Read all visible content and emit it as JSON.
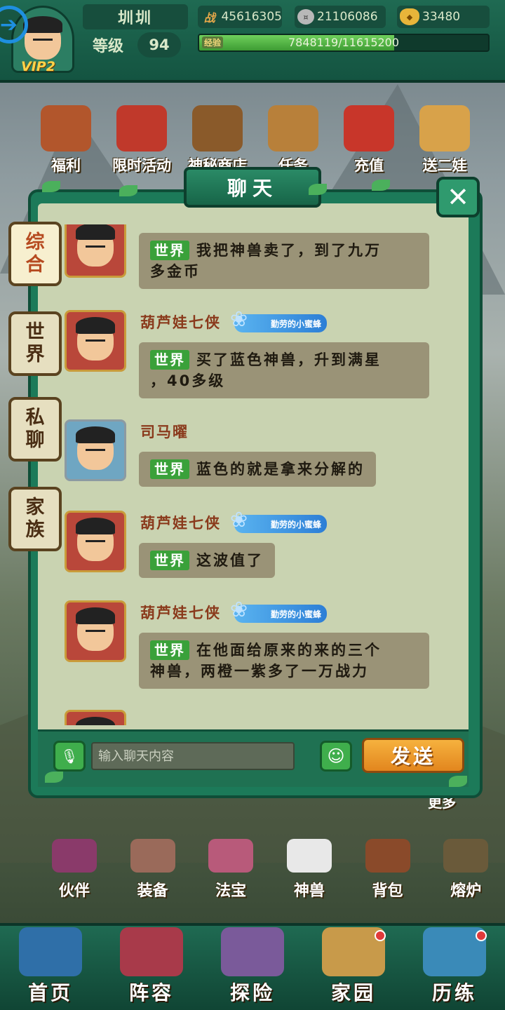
{
  "top_bar": {
    "player_name": "圳圳",
    "vip_label": "VIP2",
    "level_label": "等级",
    "level_value": "94",
    "power_icon_char": "战",
    "power_value": "45616305",
    "silver_value": "21106086",
    "gold_value": "33480",
    "exp_label": "经验",
    "exp_text": "7848119/11615200",
    "exp_fraction": 0.6757
  },
  "top_menu": [
    {
      "label": "福利",
      "icon": "gift-icon",
      "color": "#b2562c"
    },
    {
      "label": "限时活动",
      "icon": "drum-icon",
      "color": "#c0392b"
    },
    {
      "label": "神秘商店",
      "icon": "shop-icon",
      "color": "#8a5a2a"
    },
    {
      "label": "任务",
      "icon": "scroll-icon",
      "color": "#b8803a"
    },
    {
      "label": "充值",
      "icon": "treasure-bag-icon",
      "color": "#c8362a"
    },
    {
      "label": "送二娃",
      "icon": "character-icon",
      "color": "#d8a24a"
    }
  ],
  "chat": {
    "title": "聊天",
    "tabs": [
      {
        "label_top": "综",
        "label_bottom": "合",
        "active": true
      },
      {
        "label_top": "世",
        "label_bottom": "界",
        "active": false
      },
      {
        "label_top": "私",
        "label_bottom": "聊",
        "active": false
      },
      {
        "label_top": "家",
        "label_bottom": "族",
        "active": false
      }
    ],
    "messages": [
      {
        "name": "",
        "badge": "",
        "channel": "世界",
        "line1": "我把神兽卖了，到了九万",
        "line2": "多金币",
        "avatar": "red"
      },
      {
        "name": "葫芦娃七侠",
        "badge": "勤劳的小蜜蜂",
        "channel": "世界",
        "line1": "买了蓝色神兽，升到满星",
        "line2": "，40多级",
        "avatar": "red"
      },
      {
        "name": "司马曜",
        "badge": "",
        "channel": "世界",
        "line1": "蓝色的就是拿来分解的",
        "line2": "",
        "avatar": "blue"
      },
      {
        "name": "葫芦娃七侠",
        "badge": "勤劳的小蜜蜂",
        "channel": "世界",
        "line1": "这波值了",
        "line2": "",
        "avatar": "red"
      },
      {
        "name": "葫芦娃七侠",
        "badge": "勤劳的小蜜蜂",
        "channel": "世界",
        "line1": "在他面给原来的来的三个",
        "line2": "神兽，两橙一紫多了一万战力",
        "avatar": "red"
      }
    ],
    "input_placeholder": "输入聊天内容",
    "send_label": "发送"
  },
  "more_label": "更多",
  "mid_menu": [
    {
      "label": "伙伴",
      "color": "#8a3a6a"
    },
    {
      "label": "装备",
      "color": "#9a6a5a"
    },
    {
      "label": "法宝",
      "color": "#b85a7a"
    },
    {
      "label": "神兽",
      "color": "#e8e8e8"
    },
    {
      "label": "背包",
      "color": "#8a4a2a"
    },
    {
      "label": "熔炉",
      "color": "#6a5a3a"
    }
  ],
  "bottom_nav": [
    {
      "label": "首页",
      "color": "#2f6fa8",
      "dot": false
    },
    {
      "label": "阵容",
      "color": "#a83a4a",
      "dot": false
    },
    {
      "label": "探险",
      "color": "#7a5a9a",
      "dot": false
    },
    {
      "label": "家园",
      "color": "#c89a4a",
      "dot": true
    },
    {
      "label": "历练",
      "color": "#3a8ab8",
      "dot": true
    }
  ]
}
